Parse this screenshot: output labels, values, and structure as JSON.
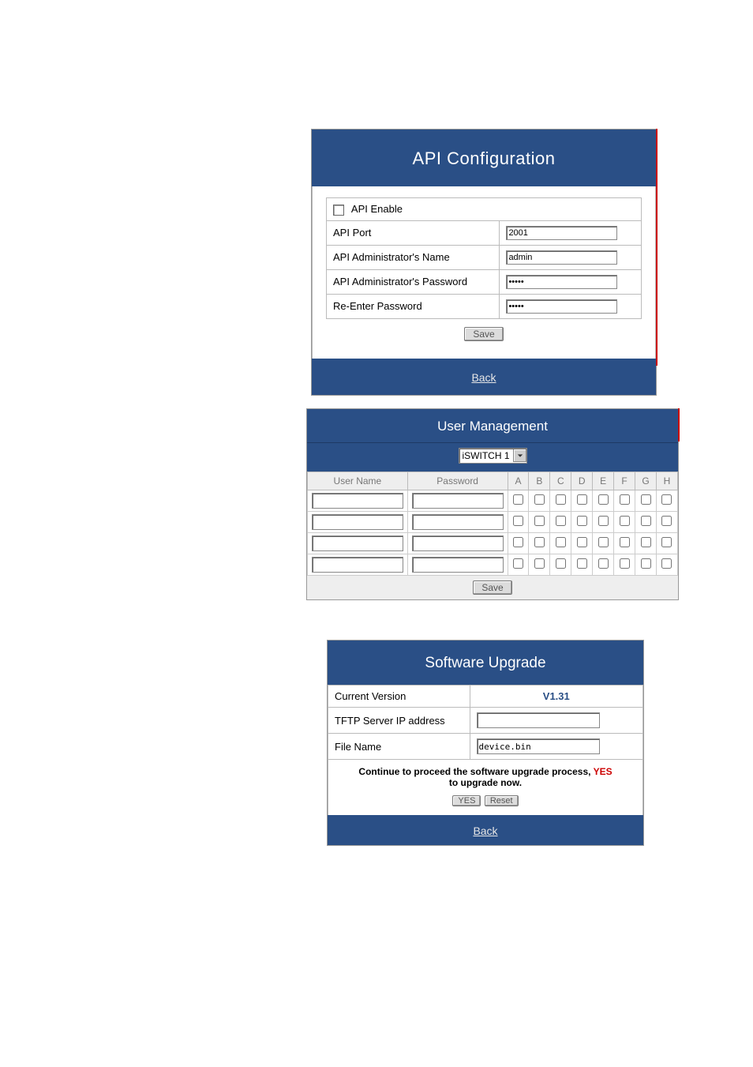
{
  "api": {
    "title": "API Configuration",
    "enable_label": "API Enable",
    "rows": {
      "port_label": "API Port",
      "port_value": "2001",
      "admin_name_label": "API Administrator's Name",
      "admin_name_value": "admin",
      "admin_pass_label": "API Administrator's Password",
      "admin_pass_value": "*****",
      "repass_label": "Re-Enter Password",
      "repass_value": "*****"
    },
    "save_label": "Save",
    "back_label": "Back"
  },
  "um": {
    "title": "User Management",
    "selector_value": "iSWITCH 1",
    "cols": [
      "A",
      "B",
      "C",
      "D",
      "E",
      "F",
      "G",
      "H"
    ],
    "headers": {
      "user": "User Name",
      "pass": "Password"
    },
    "save_label": "Save"
  },
  "su": {
    "title": "Software Upgrade",
    "cur_ver_label": "Current Version",
    "cur_ver_value": "V1.31",
    "tftp_label": "TFTP Server IP address",
    "tftp_value": "",
    "file_label": "File Name",
    "file_value": "device.bin",
    "note_a": "Continue to proceed the software upgrade process, ",
    "note_yes": "YES",
    "note_b": " to upgrade now.",
    "yes_label": "YES",
    "reset_label": "Reset",
    "back_label": "Back"
  }
}
